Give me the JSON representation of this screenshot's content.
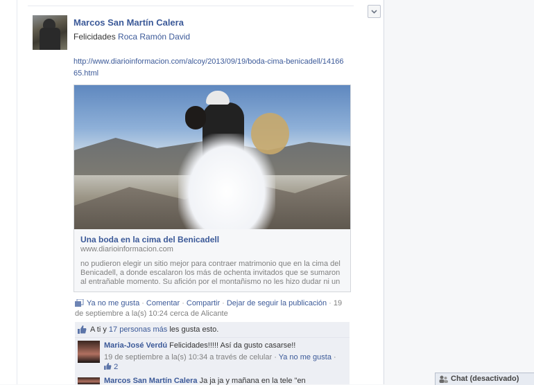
{
  "post": {
    "author": "Marcos San Martín Calera",
    "message_prefix": "Felicidades",
    "message_mention": "Roca Ramón David",
    "url": "http://www.diarioinformacion.com/alcoy/2013/09/19/boda-cima-benicadell/1416665.html",
    "link_card": {
      "title": "Una boda en la cima del Benicadell",
      "domain": "www.diarioinformacion.com",
      "description": "no pudieron elegir un sitio mejor para contraer matrimonio que en la cima del Benicadell, a donde escalaron los más de ochenta invitados que se sumaron al entrañable momento. Su afición por el montañismo no les hizo dudar ni un"
    },
    "actions": {
      "unlike": "Ya no me gusta",
      "comment": "Comentar",
      "share": "Compartir",
      "unfollow": "Dejar de seguir la publicación",
      "timestamp": "19 de septiembre a la(s) 10:24 cerca de Alicante"
    }
  },
  "likes": {
    "prefix": "A ti y",
    "link": "17 personas más",
    "suffix": "les gusta esto."
  },
  "comments": [
    {
      "author": "Maria-José Verdú",
      "text": "Felicidades!!!!! Así da gusto casarse!!",
      "meta": "19 de septiembre a la(s) 10:34 a través de celular",
      "unlike": "Ya no me gusta",
      "likes": "2"
    },
    {
      "author": "Marcos San Martín Calera",
      "text": "Ja ja ja y mañana en la tele \"en"
    }
  ],
  "chat": {
    "label": "Chat (desactivado)"
  },
  "colors": {
    "link": "#3b5998",
    "muted": "#808080",
    "comment_bg": "#edeff4"
  }
}
